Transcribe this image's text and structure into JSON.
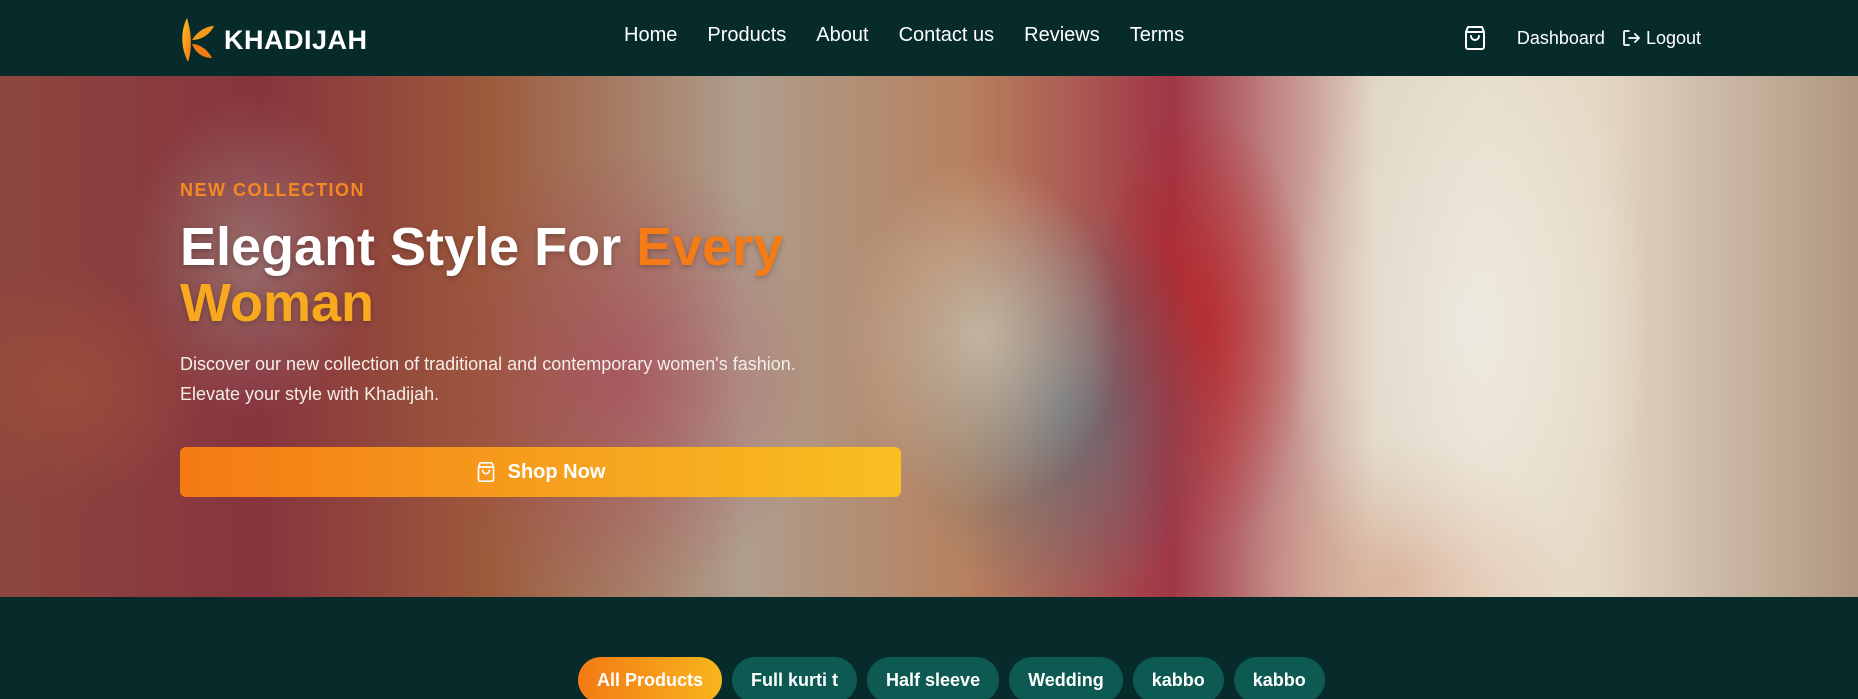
{
  "brand": {
    "name": "KHADIJAH",
    "logo_icon": "leaf-logo-icon"
  },
  "nav": {
    "links": [
      {
        "label": "Home"
      },
      {
        "label": "Products"
      },
      {
        "label": "About"
      },
      {
        "label": "Contact us"
      },
      {
        "label": "Reviews"
      },
      {
        "label": "Terms"
      }
    ],
    "cart_icon": "shopping-bag-icon",
    "dashboard_label": "Dashboard",
    "logout_label": "Logout",
    "logout_icon": "logout-icon"
  },
  "hero": {
    "kicker": "NEW COLLECTION",
    "title_part1": "Elegant Style For ",
    "title_accent1": "Every",
    "title_accent2": "Woman",
    "description_line1": "Discover our new collection of traditional and contemporary women's fashion.",
    "description_line2": "Elevate your style with Khadijah.",
    "cta_label": "Shop Now",
    "cta_icon": "shopping-bag-icon"
  },
  "filters": {
    "items": [
      {
        "label": "All Products",
        "active": true
      },
      {
        "label": "Full kurti t",
        "active": false
      },
      {
        "label": "Half sleeve",
        "active": false
      },
      {
        "label": "Wedding",
        "active": false
      },
      {
        "label": "kabbo",
        "active": false
      },
      {
        "label": "kabbo",
        "active": false
      }
    ]
  },
  "colors": {
    "navbar_bg": "#062b2a",
    "accent_orange": "#f47b16",
    "accent_yellow": "#f8a91e",
    "chip_bg": "#0d5a52"
  }
}
